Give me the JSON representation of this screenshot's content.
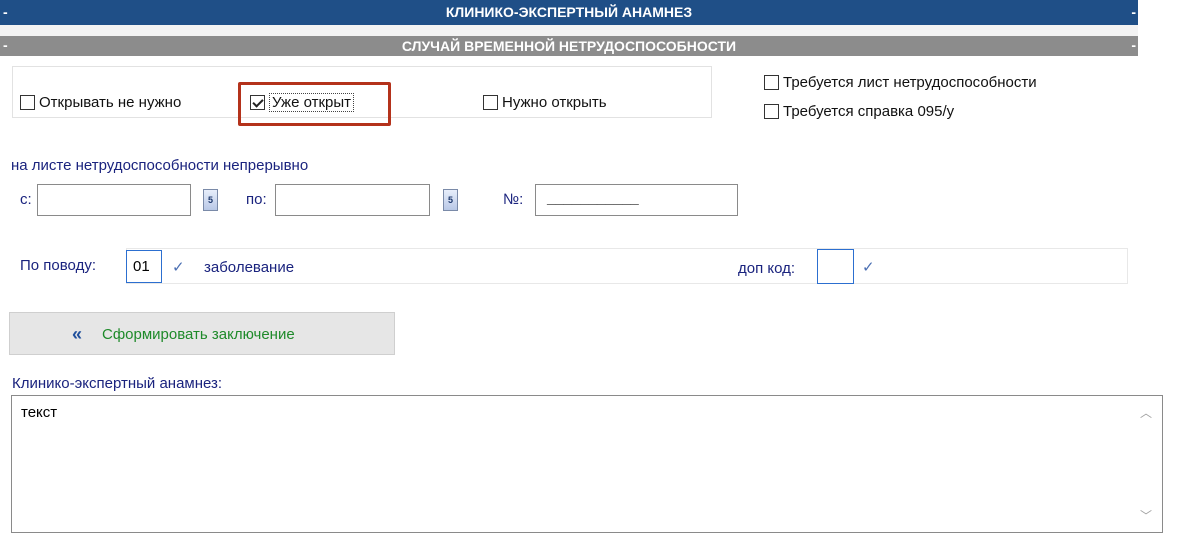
{
  "header": {
    "title": "КЛИНИКО-ЭКСПЕРТНЫЙ АНАМНЕЗ",
    "collapse_mark": "-"
  },
  "section": {
    "title": "СЛУЧАЙ ВРЕМЕННОЙ НЕТРУДОСПОСОБНОСТИ",
    "collapse_mark": "-"
  },
  "options": {
    "not_needed": {
      "label": "Открывать не нужно",
      "checked": false
    },
    "already_open": {
      "label": "Уже открыт",
      "checked": true
    },
    "need_open": {
      "label": "Нужно открыть",
      "checked": false
    },
    "sick_leave_required": {
      "label": "Требуется лист нетрудоспособности",
      "checked": false
    },
    "certificate_required": {
      "label": "Требуется справка 095/у",
      "checked": false
    }
  },
  "period": {
    "heading": "на листе нетрудоспособности непрерывно",
    "from_label": "с:",
    "from_value": "",
    "to_label": "по:",
    "to_value": "",
    "number_label": "№:",
    "number_value": "___________",
    "calendar_glyph": "5"
  },
  "reason": {
    "label": "По поводу:",
    "code": "01",
    "text": "заболевание",
    "extra_code_label": "доп код:",
    "extra_code_value": ""
  },
  "generate_button": {
    "label": "Сформировать заключение",
    "icon": "double-chevron-left-icon"
  },
  "anamnesis": {
    "label": "Клинико-экспертный анамнез:",
    "value": "текст"
  }
}
